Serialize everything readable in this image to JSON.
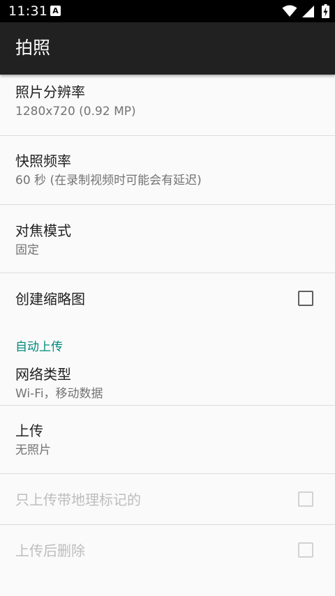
{
  "status_bar": {
    "time": "11:31",
    "app_icon": "A",
    "icons": [
      "wifi-icon",
      "cell-signal-icon",
      "battery-charging-icon"
    ]
  },
  "app_bar": {
    "title": "拍照"
  },
  "prefs": {
    "resolution": {
      "title": "照片分辨率",
      "summary": "1280x720 (0.92 MP)"
    },
    "snapshot_rate": {
      "title": "快照频率",
      "summary": "60 秒 (在录制视频时可能会有延迟)"
    },
    "focus_mode": {
      "title": "对焦模式",
      "summary": "固定"
    },
    "thumbnails": {
      "title": "创建缩略图",
      "checked": false
    }
  },
  "auto_upload": {
    "category": "自动上传",
    "network_type": {
      "title": "网络类型",
      "summary": "Wi-Fi，移动数据"
    },
    "upload": {
      "title": "上传",
      "summary": "无照片"
    },
    "geotagged_only": {
      "title": "只上传带地理标记的",
      "checked": false,
      "enabled": false
    },
    "delete_after": {
      "title": "上传后删除",
      "checked": false,
      "enabled": false
    }
  },
  "colors": {
    "status_bar": "#000000",
    "app_bar": "#212121",
    "accent": "#00897b",
    "background": "#fafafa"
  }
}
